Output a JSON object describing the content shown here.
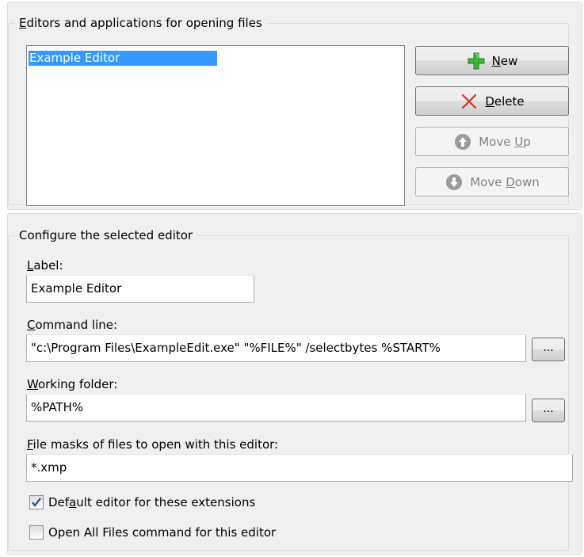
{
  "editors_group": {
    "title": "Editors and applications for opening files",
    "mnemonic": "E",
    "title_rest": "ditors and applications for opening files",
    "items": [
      {
        "label": "Example Editor",
        "selected": true
      }
    ]
  },
  "buttons": {
    "new": {
      "mnemonic": "N",
      "rest": "ew",
      "icon": "green-plus-icon",
      "enabled": true
    },
    "delete": {
      "mnemonic": "D",
      "rest": "elete",
      "icon": "red-x-icon",
      "enabled": true
    },
    "move_up": {
      "pre": "Move ",
      "mnemonic": "U",
      "rest": "p",
      "icon": "arrow-up-circle-icon",
      "enabled": false
    },
    "move_down": {
      "pre": "Move ",
      "mnemonic": "D",
      "rest": "own",
      "icon": "arrow-down-circle-icon",
      "enabled": false
    }
  },
  "config_group": {
    "title": "Configure the selected editor",
    "label_field": {
      "mnemonic": "L",
      "rest": "abel:",
      "value": "Example Editor"
    },
    "command_line": {
      "mnemonic": "C",
      "rest": "ommand line:",
      "value": "\"c:\\Program Files\\ExampleEdit.exe\" \"%FILE%\" /selectbytes %START%",
      "browse_label": "..."
    },
    "working_folder": {
      "mnemonic": "W",
      "rest": "orking folder:",
      "value": "%PATH%",
      "browse_label": "..."
    },
    "file_masks": {
      "mnemonic": "F",
      "rest": "ile masks of files to open with this editor:",
      "value": "*.xmp"
    },
    "default_editor": {
      "pre": "Def",
      "mnemonic": "a",
      "rest": "ult editor for these extensions",
      "checked": true
    },
    "open_all": {
      "label": "Open All Files command for this editor",
      "checked": false
    }
  },
  "colors": {
    "selection": "#3399ff",
    "panel": "#f0f0f0",
    "check": "#2a4d8c"
  }
}
